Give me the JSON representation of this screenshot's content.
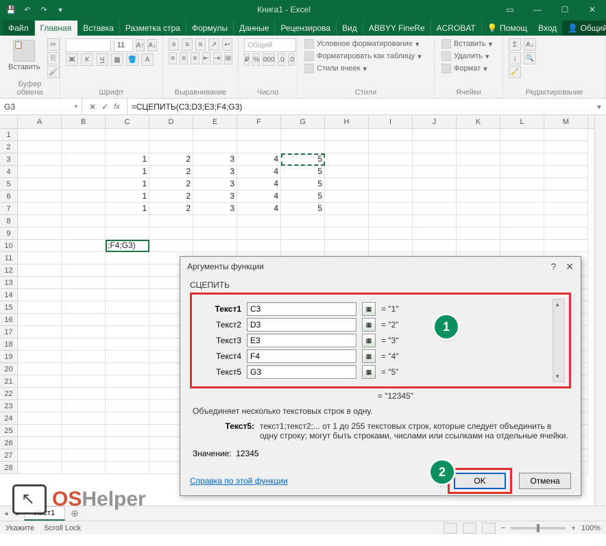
{
  "titlebar": {
    "title": "Книга1 - Excel"
  },
  "tabs": {
    "file": "Файл",
    "items": [
      "Главная",
      "Вставка",
      "Разметка стра",
      "Формулы",
      "Данные",
      "Рецензирова",
      "Вид",
      "ABBYY FineRe",
      "ACROBAT"
    ],
    "help": "Помощ",
    "signin": "Вход",
    "share": "Общий доступ"
  },
  "ribbon": {
    "clipboard": {
      "paste": "Вставить",
      "label": "Буфер обмена"
    },
    "font": {
      "size": "11",
      "label": "Шрифт"
    },
    "align": {
      "label": "Выравнивание"
    },
    "number": {
      "format": "Общий",
      "label": "Число"
    },
    "styles": {
      "cond": "Условное форматирование",
      "table": "Форматировать как таблицу",
      "cell": "Стили ячеек",
      "label": "Стили"
    },
    "cells": {
      "insert": "Вставить",
      "delete": "Удалить",
      "format": "Формат",
      "label": "Ячейки"
    },
    "editing": {
      "label": "Редактирование"
    }
  },
  "namebox": "G3",
  "formula": "=СЦЕПИТЬ(C3;D3;E3;F4;G3)",
  "columns": [
    "A",
    "B",
    "C",
    "D",
    "E",
    "F",
    "G",
    "H",
    "I",
    "J",
    "K",
    "L",
    "M"
  ],
  "rowcount": 28,
  "gridrows": [
    {
      "r": 3,
      "c": {
        "C": "1",
        "D": "2",
        "E": "3",
        "F": "4",
        "G": "5"
      }
    },
    {
      "r": 4,
      "c": {
        "C": "1",
        "D": "2",
        "E": "3",
        "F": "4",
        "G": "5"
      }
    },
    {
      "r": 5,
      "c": {
        "C": "1",
        "D": "2",
        "E": "3",
        "F": "4",
        "G": "5"
      }
    },
    {
      "r": 6,
      "c": {
        "C": "1",
        "D": "2",
        "E": "3",
        "F": "4",
        "G": "5"
      }
    },
    {
      "r": 7,
      "c": {
        "C": "1",
        "D": "2",
        "E": "3",
        "F": "4",
        "G": "5"
      }
    }
  ],
  "activecell": {
    "r": 10,
    "col": "C",
    "text": ";F4;G3)"
  },
  "selcell": {
    "r": 3,
    "col": "G"
  },
  "dialog": {
    "title": "Аргументы функции",
    "fn": "СЦЕПИТЬ",
    "args": [
      {
        "label": "Текст1",
        "bold": true,
        "val": "C3",
        "res": "= \"1\""
      },
      {
        "label": "Текст2",
        "bold": false,
        "val": "D3",
        "res": "= \"2\""
      },
      {
        "label": "Текст3",
        "bold": false,
        "val": "E3",
        "res": "= \"3\""
      },
      {
        "label": "Текст4",
        "bold": false,
        "val": "F4",
        "res": "= \"4\""
      },
      {
        "label": "Текст5",
        "bold": false,
        "val": "G3",
        "res": "= \"5\""
      }
    ],
    "result_marker": "= \"12345\"",
    "desc": "Объединяет несколько текстовых строк в одну.",
    "argname": "Текст5:",
    "argdesc": "текст1;текст2;... от 1 до 255 текстовых строк, которые следует объединить в одну строку; могут быть строками, числами или ссылками на отдельные ячейки.",
    "val_label": "Значение:",
    "val": "12345",
    "help": "Справка по этой функции",
    "ok": "OK",
    "cancel": "Отмена"
  },
  "callouts": {
    "c1": "1",
    "c2": "2"
  },
  "sheet": "Лист1",
  "status": {
    "mode": "Укажите",
    "scroll": "Scroll Lock",
    "zoom": "100%"
  },
  "watermark": {
    "a": "OS",
    "b": "Helper"
  }
}
